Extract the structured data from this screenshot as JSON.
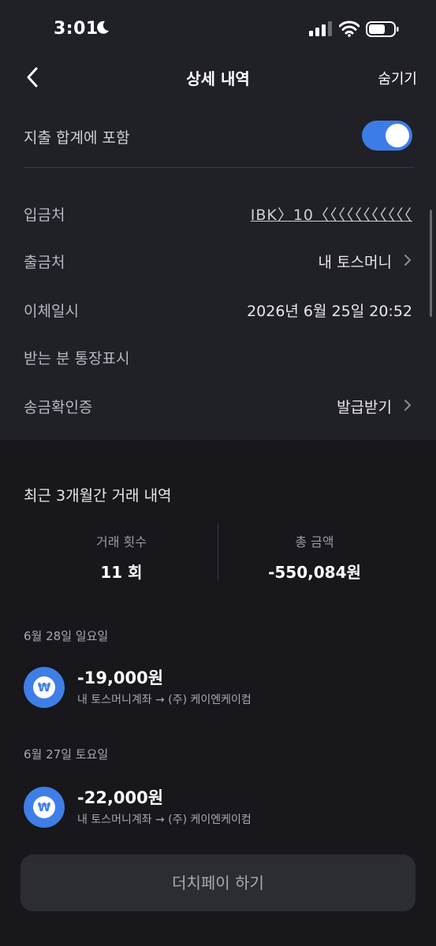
{
  "status_bar": {
    "time": "3:01"
  },
  "nav": {
    "title": "상세 내역",
    "hide_label": "숨기기"
  },
  "toggle": {
    "label": "지출 합계에 포함",
    "on": true
  },
  "details": [
    {
      "label": "입금처",
      "value": "IBK〉10〈〈〈〈〈〈〈〈〈〈〈"
    },
    {
      "label": "출금처",
      "value": "내 토스머니"
    },
    {
      "label": "이체일시",
      "value": "2026년 6월 25일 20:52"
    },
    {
      "label": "받는 분 통장표시",
      "value": ""
    },
    {
      "label": "송금확인증",
      "value": "발급받기"
    }
  ],
  "recent": {
    "title": "최근 3개월간 거래 내역",
    "count_label": "거래 횟수",
    "count_value": "11 회",
    "total_label": "총 금액",
    "total_value": "-550,084원"
  },
  "transactions": [
    {
      "date": "6월 28일 일요일",
      "amount": "-19,000원",
      "desc": "내 토스머니계좌 → (주) 케이엔케이컴",
      "icon": "won-coin-icon"
    },
    {
      "date": "6월 27일 토요일",
      "amount": "-22,000원",
      "desc": "내 토스머니계좌 → (주) 케이엔케이컴",
      "icon": "won-coin-icon"
    }
  ],
  "dutch_pay": {
    "label": "더치페이 하기"
  },
  "colors": {
    "accent": "#3c7ce6",
    "background": "#17171c",
    "card": "#202027"
  }
}
